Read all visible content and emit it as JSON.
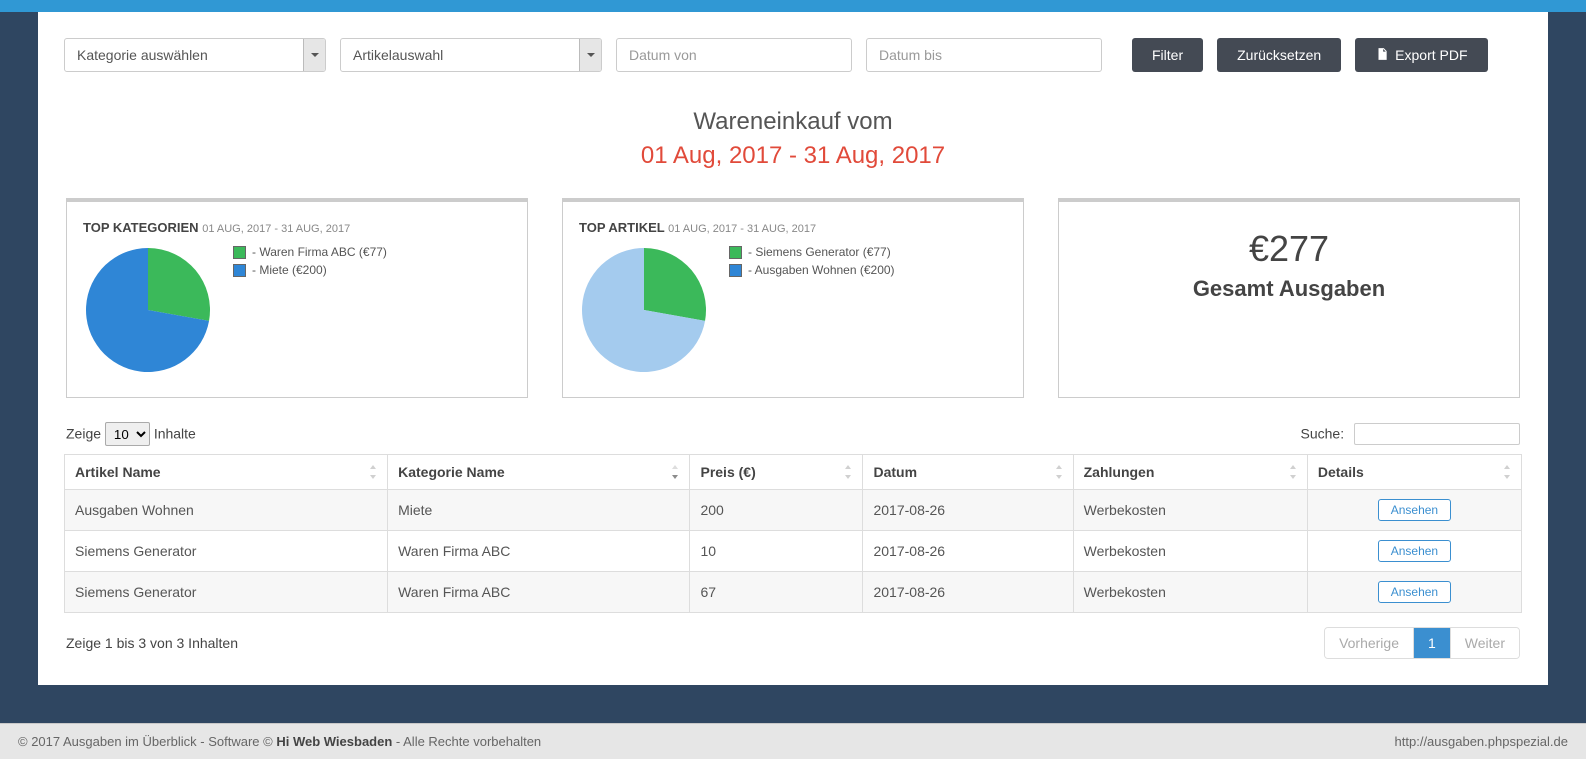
{
  "filters": {
    "category_placeholder": "Kategorie auswählen",
    "article_placeholder": "Artikelauswahl",
    "date_from_placeholder": "Datum von",
    "date_to_placeholder": "Datum bis",
    "filter_btn": "Filter",
    "reset_btn": "Zurücksetzen",
    "export_btn": "Export PDF"
  },
  "title": {
    "heading": "Wareneinkauf vom",
    "range": "01 Aug, 2017 - 31 Aug, 2017"
  },
  "cards": {
    "kat": {
      "title": "TOP KATEGORIEN",
      "sub": "01 AUG, 2017 - 31 AUG, 2017",
      "legend1": " - Waren Firma ABC (€77)",
      "legend2": " - Miete (€200)"
    },
    "art": {
      "title": "TOP ARTIKEL",
      "sub": "01 AUG, 2017 - 31 AUG, 2017",
      "legend1": " - Siemens Generator (€77)",
      "legend2": " - Ausgaben Wohnen (€200)"
    },
    "total": {
      "amount": "€277",
      "label": "Gesamt Ausgaben"
    }
  },
  "datatable": {
    "len_pre": "Zeige",
    "len_val": "10",
    "len_post": "Inhalte",
    "search_label": "Suche:",
    "cols": {
      "c0": "Artikel Name",
      "c1": "Kategorie Name",
      "c2": "Preis (€)",
      "c3": "Datum",
      "c4": "Zahlungen",
      "c5": "Details"
    },
    "rows": [
      {
        "a": "Ausgaben Wohnen",
        "k": "Miete",
        "p": "200",
        "d": "2017-08-26",
        "z": "Werbekosten",
        "btn": "Ansehen"
      },
      {
        "a": "Siemens Generator",
        "k": "Waren Firma ABC",
        "p": "10",
        "d": "2017-08-26",
        "z": "Werbekosten",
        "btn": "Ansehen"
      },
      {
        "a": "Siemens Generator",
        "k": "Waren Firma ABC",
        "p": "67",
        "d": "2017-08-26",
        "z": "Werbekosten",
        "btn": "Ansehen"
      }
    ],
    "info": "Zeige 1 bis 3 von 3 Inhalten",
    "prev": "Vorherige",
    "page": "1",
    "next": "Weiter"
  },
  "footer": {
    "left_pre": "© 2017 Ausgaben im Überblick - Software © ",
    "left_bold": "Hi Web Wiesbaden",
    "left_post": " - Alle Rechte vorbehalten",
    "right": "http://ausgaben.phpspezial.de"
  },
  "chart_data": [
    {
      "type": "pie",
      "title": "TOP KATEGORIEN",
      "series": [
        {
          "name": "Waren Firma ABC",
          "value": 77,
          "color": "#3bb95a"
        },
        {
          "name": "Miete",
          "value": 200,
          "color": "#2f86d6"
        }
      ]
    },
    {
      "type": "pie",
      "title": "TOP ARTIKEL",
      "series": [
        {
          "name": "Siemens Generator",
          "value": 77,
          "color": "#3bb95a"
        },
        {
          "name": "Ausgaben Wohnen",
          "value": 200,
          "color": "#a4cbee"
        }
      ]
    }
  ]
}
